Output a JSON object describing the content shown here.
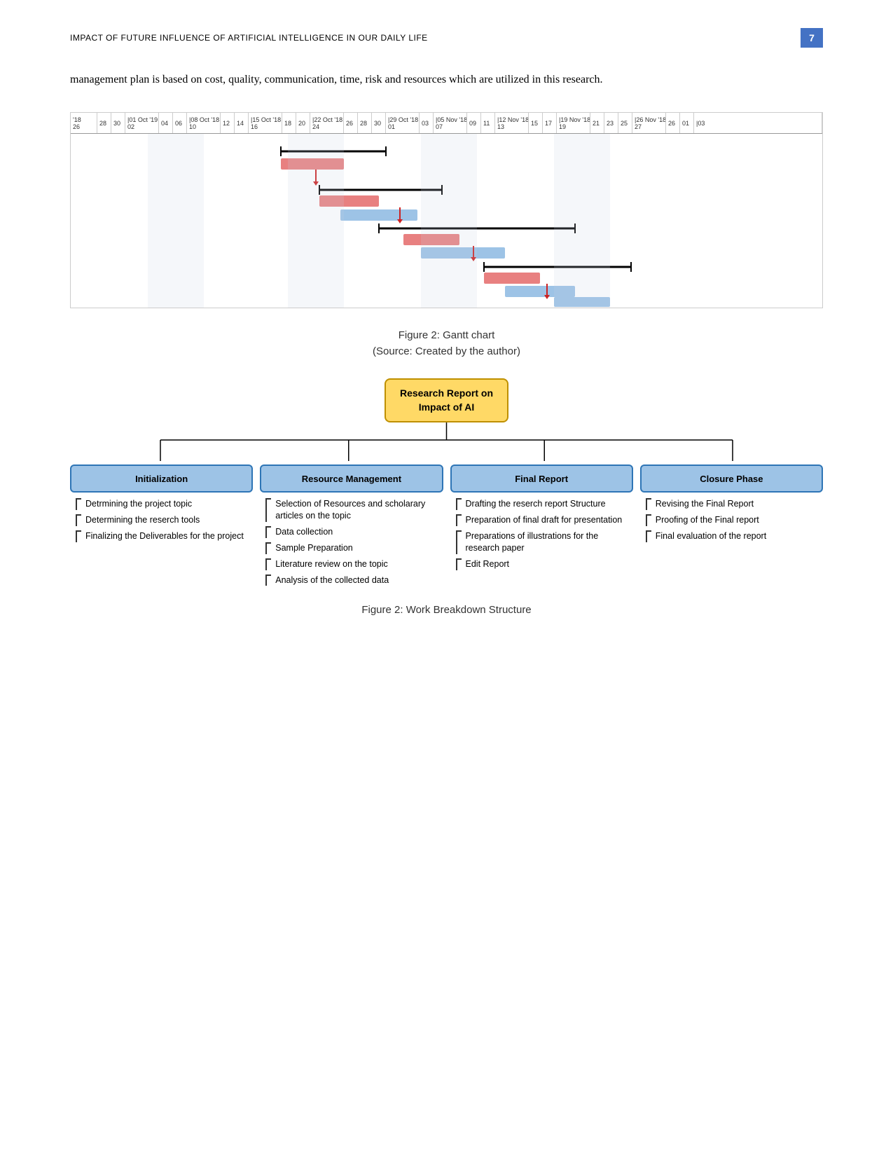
{
  "header": {
    "title": "IMPACT OF FUTURE INFLUENCE OF ARTIFICIAL INTELLIGENCE IN OUR DAILY LIFE",
    "page_number": "7"
  },
  "body_text": "management plan is based on cost, quality, communication, time, risk and resources which are utilized in this research.",
  "figure1": {
    "caption": "Figure 2: Gantt chart",
    "source": "(Source: Created by the author)"
  },
  "figure2": {
    "caption": "Figure 2: Work Breakdown Structure"
  },
  "wbs": {
    "root": {
      "line1": "Research Report on",
      "line2": "Impact of AI"
    },
    "children": [
      {
        "header": "Initialization",
        "items": [
          "Detrmining the project topic",
          "Determining the reserch tools",
          "Finalizing the Deliverables for the project"
        ]
      },
      {
        "header": "Resource Management",
        "items": [
          "Selection of Resources and scholarary articles on the topic",
          "Data collection",
          "Sample Preparation",
          "Literature review on the topic",
          "Analysis of the collected data"
        ]
      },
      {
        "header": "Final Report",
        "items": [
          "Drafting the reserch report Structure",
          "Preparation of final draft for presentation",
          "Preparations of illustrations for the research paper",
          "Edit Report"
        ]
      },
      {
        "header": "Closure Phase",
        "items": [
          "Revising the Final Report",
          "Proofing of the Final report",
          "Final evaluation of the report"
        ]
      }
    ]
  },
  "gantt": {
    "columns": [
      "'18 26",
      "28",
      "30",
      "01 Oct '19",
      "02",
      "04",
      "06",
      "08 Oct '18",
      "10",
      "12",
      "14",
      "15 Oct '18",
      "16",
      "18",
      "20",
      "22 Oct '18",
      "24",
      "26",
      "28",
      "30",
      "29 Oct '18",
      "01",
      "03",
      "05 Nov '18",
      "07",
      "09",
      "11",
      "12 Nov '18",
      "13",
      "15",
      "17",
      "19 Nov '18",
      "19",
      "21",
      "23",
      "25",
      "26 Nov '18",
      "27",
      "26",
      "01",
      "03"
    ]
  }
}
